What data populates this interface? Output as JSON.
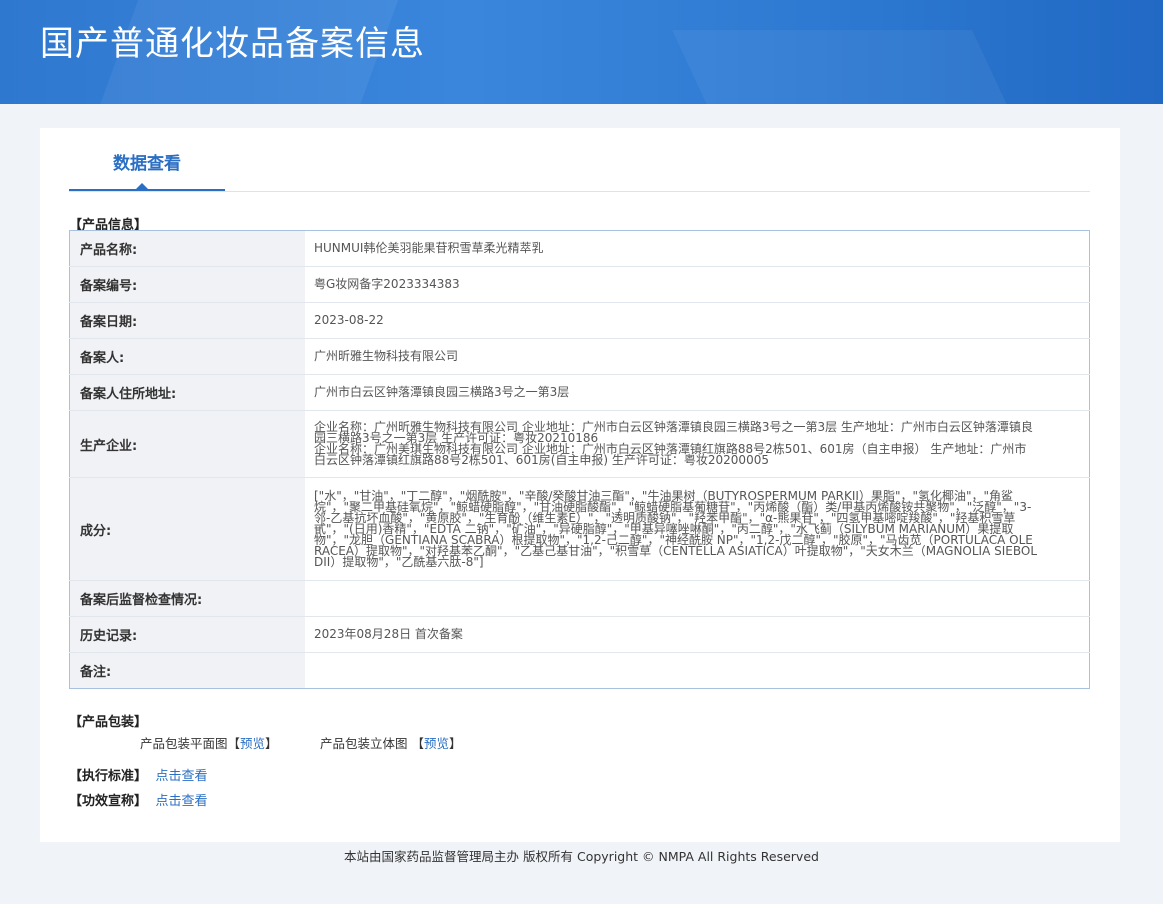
{
  "header": {
    "title": "国产普通化妆品备案信息"
  },
  "tab": {
    "label": "数据查看"
  },
  "product_info": {
    "section_label": "【产品信息】",
    "rows": [
      {
        "label": "产品名称:",
        "value": "HUNMUI韩伦美羽能果苷积雪草柔光精萃乳"
      },
      {
        "label": "备案编号:",
        "value": "粤G妆网备字2023334383"
      },
      {
        "label": "备案日期:",
        "value": "2023-08-22"
      },
      {
        "label": "备案人:",
        "value": "广州昕雅生物科技有限公司"
      },
      {
        "label": "备案人住所地址:",
        "value": "广州市白云区钟落潭镇良园三横路3号之一第3层"
      },
      {
        "label": "生产企业:",
        "value": "企业名称：广州昕雅生物科技有限公司 企业地址：广州市白云区钟落潭镇良园三横路3号之一第3层 生产地址：广州市白云区钟落潭镇良园三横路3号之一第3层 生产许可证：粤妆20210186\n企业名称：广州美琪生物科技有限公司 企业地址：广州市白云区钟落潭镇红旗路88号2栋501、601房（自主申报） 生产地址：广州市白云区钟落潭镇红旗路88号2栋501、601房(自主申报) 生产许可证：粤妆20200005"
      },
      {
        "label": "成分:",
        "value": "[\"水\"，\"甘油\"，\"丁二醇\"，\"烟酰胺\"，\"辛酸/癸酸甘油三酯\"，\"牛油果树（BUTYROSPERMUM PARKII）果脂\"，\"氢化椰油\"，\"角鲨烷\"，\"聚二甲基硅氧烷\"，\"鲸蜡硬脂醇\"，\"甘油硬脂酸酯\"，\"鲸蜡硬脂基葡糖苷\"，\"丙烯酸（酯）类/甲基丙烯酸铵共聚物\"，\"泛醇\"，\"3-邻-乙基抗坏血酸\"，\"黄原胶\"，\"生育酚（维生素E）\"，\"透明质酸钠\"，\"羟苯甲酯\"，\"α-熊果苷\"，\"四氢甲基嘧啶羧酸\"，\"羟基积雪草甙\"，\"(日用)香精\"，\"EDTA 二钠\"，\"矿油\"，\"异硬脂醇\"，\"甲基异噻唑啉酮\"，\"丙二醇\"，\"水飞蓟（SILYBUM MARIANUM）果提取物\"，\"龙胆（GENTIANA SCABRA）根提取物\"，\"1,2-己二醇\"，\"神经酰胺 NP\"，\"1,2-戊二醇\"，\"胶原\"，\"马齿苋（PORTULACA OLERACEA）提取物\"，\"对羟基苯乙酮\"，\"乙基己基甘油\"，\"积雪草（CENTELLA ASIATICA）叶提取物\"，\"天女木兰（MAGNOLIA SIEBOLDII）提取物\"，\"乙酰基六肽-8\"]"
      },
      {
        "label": "备案后监督检查情况:",
        "value": ""
      },
      {
        "label": "历史记录:",
        "value": "2023年08月28日 首次备案"
      },
      {
        "label": "备注:",
        "value": ""
      }
    ]
  },
  "packaging": {
    "section_label": "【产品包装】",
    "flat_label": "产品包装平面图",
    "stereo_label": "产品包装立体图",
    "bracket_open": "【",
    "bracket_close": "】",
    "preview_label": "预览"
  },
  "standard": {
    "label": "【执行标准】",
    "link": "点击查看"
  },
  "efficacy": {
    "label": "【功效宣称】",
    "link": "点击查看"
  },
  "footer": {
    "text": "本站由国家药品监督管理局主办 版权所有 Copyright © NMPA All Rights Reserved"
  }
}
